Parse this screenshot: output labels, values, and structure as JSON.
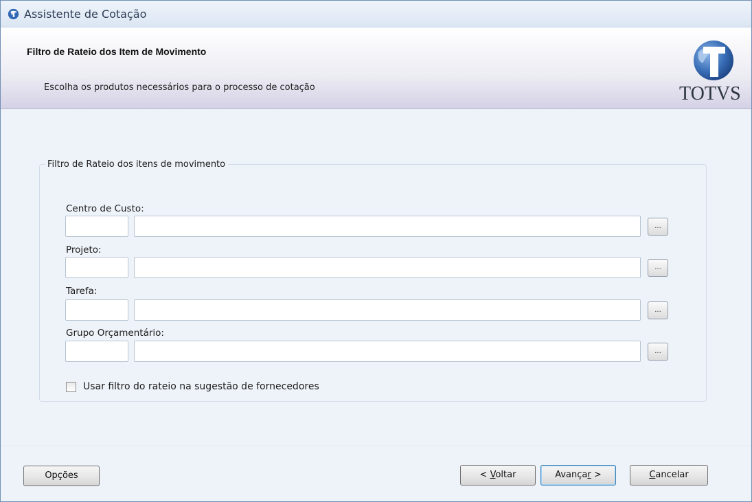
{
  "window": {
    "title": "Assistente de Cotação"
  },
  "header": {
    "title": "Filtro de Rateio dos Item de Movimento",
    "subtitle": "Escolha os produtos necessários para o processo de cotação",
    "logo_text": "TOTVS"
  },
  "group": {
    "label": "Filtro de Rateio dos itens de movimento",
    "fields": [
      {
        "label": "Centro de Custo:",
        "code": "",
        "description": "",
        "lookup": "..."
      },
      {
        "label": "Projeto:",
        "code": "",
        "description": "",
        "lookup": "..."
      },
      {
        "label": "Tarefa:",
        "code": "",
        "description": "",
        "lookup": "..."
      },
      {
        "label": "Grupo Orçamentário:",
        "code": "",
        "description": "",
        "lookup": "..."
      }
    ],
    "checkbox": {
      "label": "Usar filtro do rateio na sugestão de fornecedores",
      "checked": false
    }
  },
  "footer": {
    "options": "Opções",
    "back": {
      "prefix": "< ",
      "mnemonic": "V",
      "rest": "oltar"
    },
    "next": {
      "prefix": "Avança",
      "mnemonic": "r",
      "rest": " >"
    },
    "cancel": {
      "prefix": "",
      "mnemonic": "C",
      "rest": "ancelar"
    }
  },
  "colors": {
    "window_border": "#6f8fb4",
    "header_gradient_end": "#d5d1e6",
    "default_button_border": "#3c7fb1"
  },
  "icons": {
    "title": "totvs-globe-icon",
    "logo": "totvs-logo"
  }
}
